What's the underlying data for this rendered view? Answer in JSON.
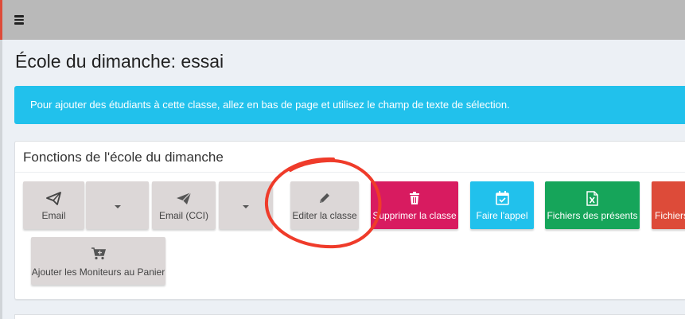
{
  "page": {
    "title": "École du dimanche: essai"
  },
  "callout": {
    "text": "Pour ajouter des étudiants à cette classe, allez en bas de page et utilisez le champ de texte de sélection."
  },
  "functions_box": {
    "title": "Fonctions de l'école du dimanche",
    "buttons": {
      "email": "Email",
      "email_bcc": "Email (CCI)",
      "edit_class": "Editer la classe",
      "delete_class": "Supprimer la classe",
      "attendance": "Faire l'appel",
      "attendance_files": "Fichiers des présents",
      "files_cut": "Fichiers",
      "add_teachers_cart": "Ajouter les Moniteurs au Panier"
    }
  },
  "colors": {
    "topbar": "#b9b9b9",
    "callout": "#21c1ec",
    "delete_button": "#d81b60",
    "attendance_button": "#21c1ec",
    "files_button": "#16a55a",
    "red_button": "#dd4b39",
    "annotation_circle": "#ef3b2a"
  },
  "icons": {
    "menu": "hamburger-icon",
    "email": "paper-plane-outline-icon",
    "email_bcc": "paper-plane-icon",
    "edit": "pencil-icon",
    "delete": "trash-icon",
    "attendance": "calendar-check-icon",
    "excel": "file-excel-icon",
    "cart": "cart-plus-icon"
  }
}
